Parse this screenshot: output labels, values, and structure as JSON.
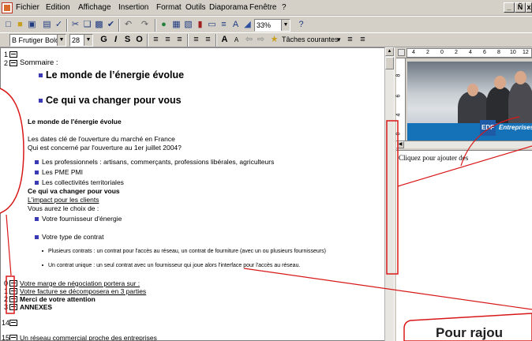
{
  "menubar": {
    "items": [
      "Fichier",
      "Edition",
      "Affichage",
      "Insertion",
      "Format",
      "Outils",
      "Diaporama",
      "Fenêtre",
      "?"
    ],
    "window_buttons": [
      "_",
      "Ñ",
      "x"
    ]
  },
  "toolbar1": {
    "zoom": "33%"
  },
  "toolbar2": {
    "font_name": "B Frutiger Bold",
    "font_size": "28",
    "common_tasks": "Tâches courantes"
  },
  "outline": {
    "lines": [
      {
        "num": "1",
        "text": ""
      },
      {
        "num": "2",
        "text": "Sommaire :"
      },
      {
        "text": "Le monde de l’énergie évolue"
      },
      {
        "text": "Ce qui va changer pour vous"
      },
      {
        "text": "Le monde de l'énergie évolue"
      },
      {
        "text": "Les dates clé de l'ouverture du marché en France"
      },
      {
        "text": "Qui est concerné par l'ouverture au 1er juillet 2004?"
      },
      {
        "text": "Les professionnels : artisans, commerçants, professions libérales, agriculteurs"
      },
      {
        "text": "Les PME PMI"
      },
      {
        "text": "Les collectivités territoriales"
      },
      {
        "text": "Ce qui va changer pour vous"
      },
      {
        "text": "L'impact pour les clients"
      },
      {
        "text": "Vous aurez le choix de :"
      },
      {
        "text": "Votre fournisseur d'énergie"
      },
      {
        "text": "Votre type de contrat"
      },
      {
        "text": "Plusieurs contrats : un contrat pour l'accès au réseau, un contrat de fourniture (avec un ou plusieurs fournisseurs)"
      },
      {
        "text": "Un contrat unique : un seul contrat avec un fournisseur qui joue alors l'interface pour l'accès au réseau."
      },
      {
        "num": "0",
        "text": "Votre marge de négociation portera sur :"
      },
      {
        "num": "1",
        "text": "Votre facture se décomposera en 3 parties"
      },
      {
        "num": "2",
        "text": "Merci de votre attention"
      },
      {
        "num": "3",
        "text": "ANNEXES"
      },
      {
        "num": "14",
        "text": ""
      },
      {
        "num": "15",
        "text": "Un réseau commercial proche des entreprises"
      }
    ]
  },
  "right_pane": {
    "ruler_numbers": [
      "4",
      "2",
      "0",
      "2",
      "4",
      "6",
      "8",
      "10",
      "12"
    ],
    "vruler_numbers": [
      "8",
      "6",
      "4",
      "0"
    ],
    "slide_logo": "EDF",
    "slide_brand": "Entreprises",
    "notes_placeholder": "Cliquez pour ajouter des"
  },
  "annotation": {
    "callout_text": "Pour rajou"
  }
}
